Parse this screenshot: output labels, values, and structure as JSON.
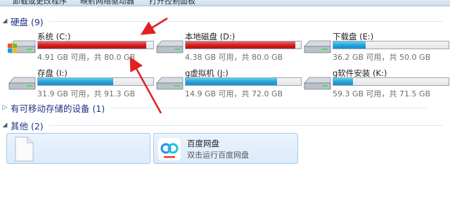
{
  "toolbar": {
    "items": [
      "卸载或更改程序",
      "映射网络驱动器",
      "打开控制面板"
    ]
  },
  "groups": {
    "hard_disks": {
      "title": "硬盘 (9)",
      "expanded": true
    },
    "removable": {
      "title": "有可移动存储的设备 (1)",
      "expanded": false
    },
    "other": {
      "title": "其他 (2)",
      "expanded": true
    }
  },
  "drives": [
    {
      "name": "系统 (C:)",
      "info": "4.91 GB 可用，共 80.0 GB",
      "used_fraction": 0.94,
      "bar_color": "red",
      "icon": "windows-drive-icon"
    },
    {
      "name": "本地磁盘 (D:)",
      "info": "4.38 GB 可用，共 80.0 GB",
      "used_fraction": 0.95,
      "bar_color": "red",
      "icon": "drive-icon"
    },
    {
      "name": "下载盘 (E:)",
      "info": "36.2 GB 可用，共 50.0 GB",
      "used_fraction": 0.28,
      "bar_color": "blue",
      "icon": "drive-icon"
    },
    {
      "name": "存盘 (I:)",
      "info": "31.9 GB 可用，共 91.3 GB",
      "used_fraction": 0.65,
      "bar_color": "blue",
      "icon": "drive-icon"
    },
    {
      "name": "g虚拟机 (J:)",
      "info": "14.9 GB 可用，共 72.0 GB",
      "used_fraction": 0.79,
      "bar_color": "blue",
      "icon": "drive-icon"
    },
    {
      "name": "g软件安装 (K:)",
      "info": "59.3 GB 可用，共 71.5 GB",
      "used_fraction": 0.17,
      "bar_color": "blue",
      "icon": "drive-icon"
    }
  ],
  "other_items": [
    {
      "name": "",
      "description": "",
      "icon": "blank-file-icon"
    },
    {
      "name": "百度网盘",
      "description": "双击运行百度网盘",
      "icon": "baidu-netdisk-icon"
    }
  ],
  "colors": {
    "group_title": "#1e3287",
    "bar_blue": "#26a0da",
    "bar_red": "#d01c1c",
    "annotation_arrow": "#e02020",
    "selection_bg": "#dcebfc"
  }
}
